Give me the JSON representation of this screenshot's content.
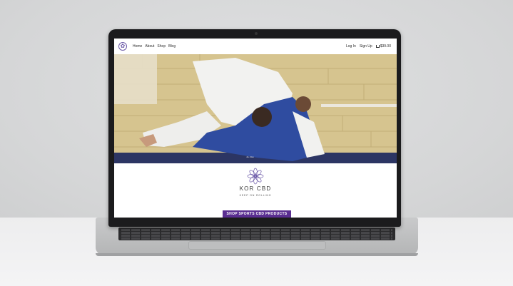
{
  "nav": {
    "logo_glyph": "✿",
    "links": [
      "Home",
      "About",
      "Shop",
      "Blog"
    ],
    "login": "Log In",
    "signup": "Sign Up",
    "cart_total": "$39.00"
  },
  "hero": {
    "caption": "Jiu Jitsu",
    "image": "two jiu-jitsu athletes grappling on a mat"
  },
  "brand": {
    "name": "KOR CBD",
    "tagline": "KEEP ON ROLLING",
    "cta": "SHOP SPORTS CBD PRODUCTS",
    "accent_color": "#5a2e91",
    "logo_color": "#6c5aa8"
  }
}
